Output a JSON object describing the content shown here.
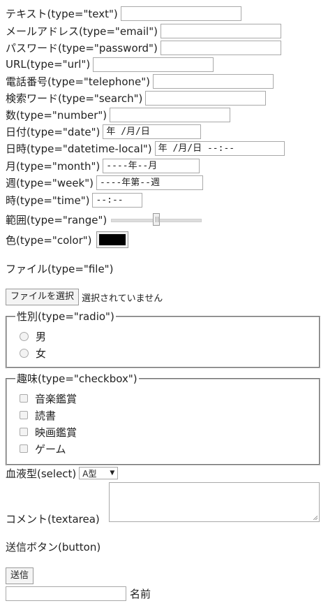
{
  "form": {
    "text_label": "テキスト(type=\"text\")",
    "email_label": "メールアドレス(type=\"email\")",
    "password_label": "パスワード(type=\"password\")",
    "url_label": "URL(type=\"url\")",
    "telephone_label": "電話番号(type=\"telephone\")",
    "search_label": "検索ワード(type=\"search\")",
    "number_label": "数(type=\"number\")",
    "date_label": "日付(type=\"date\")",
    "date_value": "年 /月/日",
    "datetime_label": "日時(type=\"datetime-local\")",
    "datetime_value": "年 /月/日 --:--",
    "month_label": "月(type=\"month\")",
    "month_value": "----年--月",
    "week_label": "週(type=\"week\")",
    "week_value": "----年第--週",
    "time_label": "時(type=\"time\")",
    "time_value": "--:--",
    "range_label": "範囲(type=\"range\")",
    "range_value_fraction": 0.5,
    "color_label": "色(type=\"color\")",
    "color_value": "#000000",
    "file_label": "ファイル(type=\"file\")",
    "file_button": "ファイルを選択",
    "file_status": "選択されていません",
    "radio_legend": "性別(type=\"radio\")",
    "radio_options": [
      "男",
      "女"
    ],
    "checkbox_legend": "趣味(type=\"checkbox\")",
    "checkbox_options": [
      "音楽鑑賞",
      "読書",
      "映画鑑賞",
      "ゲーム"
    ],
    "select_label": "血液型(select)",
    "select_value": "A型",
    "textarea_label": "コメント(textarea)",
    "button_label": "送信ボタン(button)",
    "submit_button": "送信",
    "name_label": "名前"
  },
  "icons": {
    "select_arrow": "triangle-down-icon"
  }
}
